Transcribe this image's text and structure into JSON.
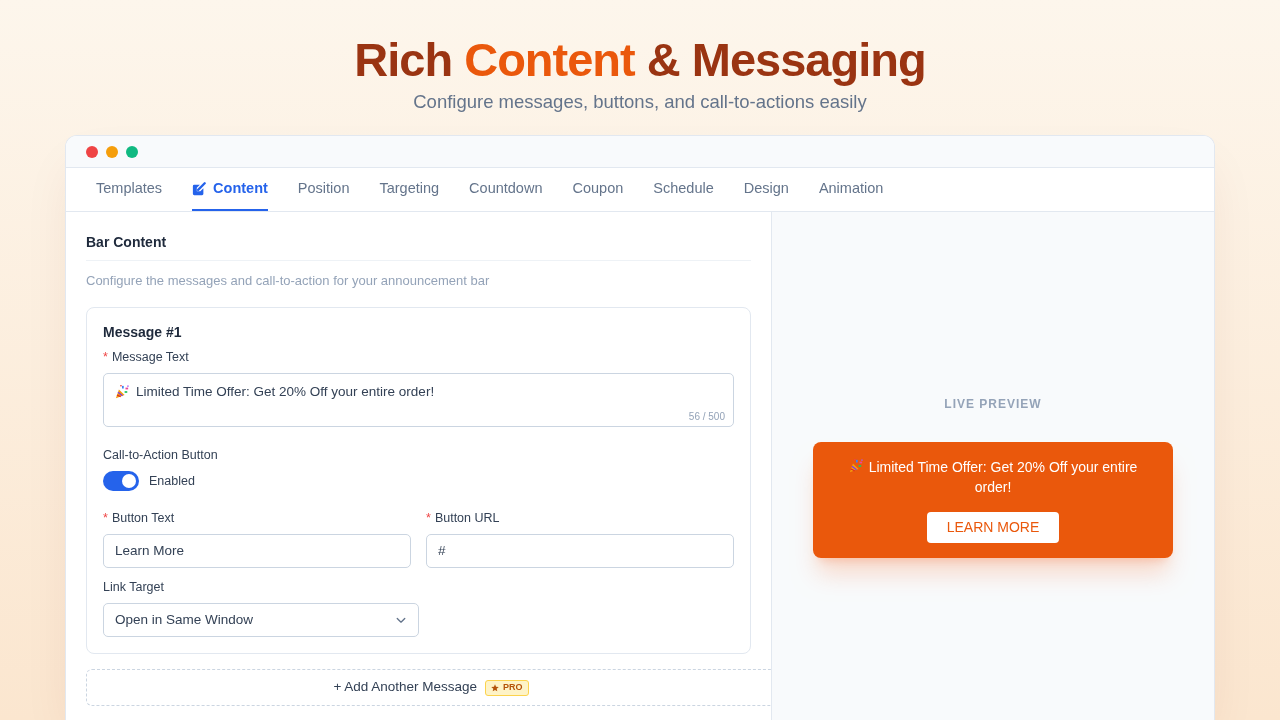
{
  "page_header": {
    "headline": "Rich **Content** & Messaging",
    "subtitle": "Configure messages, buttons, and call-to-actions easily"
  },
  "window": {
    "tabs": [
      {
        "label": "Templates",
        "selected": false
      },
      {
        "label": "Content",
        "selected": true
      },
      {
        "label": "Position",
        "selected": false
      },
      {
        "label": "Targeting",
        "selected": false
      },
      {
        "label": "Countdown",
        "selected": false
      },
      {
        "label": "Coupon",
        "selected": false
      },
      {
        "label": "Schedule",
        "selected": false
      },
      {
        "label": "Design",
        "selected": false
      },
      {
        "label": "Animation",
        "selected": false
      }
    ]
  },
  "editor": {
    "title": "Bar Content",
    "description": "Configure the messages and call-to-action for your announcement bar",
    "required_marker": "*",
    "messages": [
      {
        "title": "Message #1",
        "message_text": {
          "label": "Message Text",
          "required": true,
          "value": "Limited Time Offer: Get 20% Off your entire order!",
          "counter": "56 / 500"
        },
        "cta": {
          "label": "Call-to-Action Button",
          "on": true,
          "state_label": "Enabled"
        },
        "button_text": {
          "label": "Button Text",
          "required": true,
          "value": "Learn More"
        },
        "button_url": {
          "label": "Button URL",
          "required": true,
          "value": "#"
        },
        "link_target": {
          "label": "Link Target",
          "required": false,
          "value": "Open in Same Window"
        }
      }
    ],
    "add_button": {
      "label": "+ Add Another Message",
      "badge": "PRO"
    }
  },
  "preview": {
    "label": "LIVE PREVIEW",
    "message": "Limited Time Offer: Get 20% Off your entire order!",
    "button": "LEARN MORE"
  }
}
